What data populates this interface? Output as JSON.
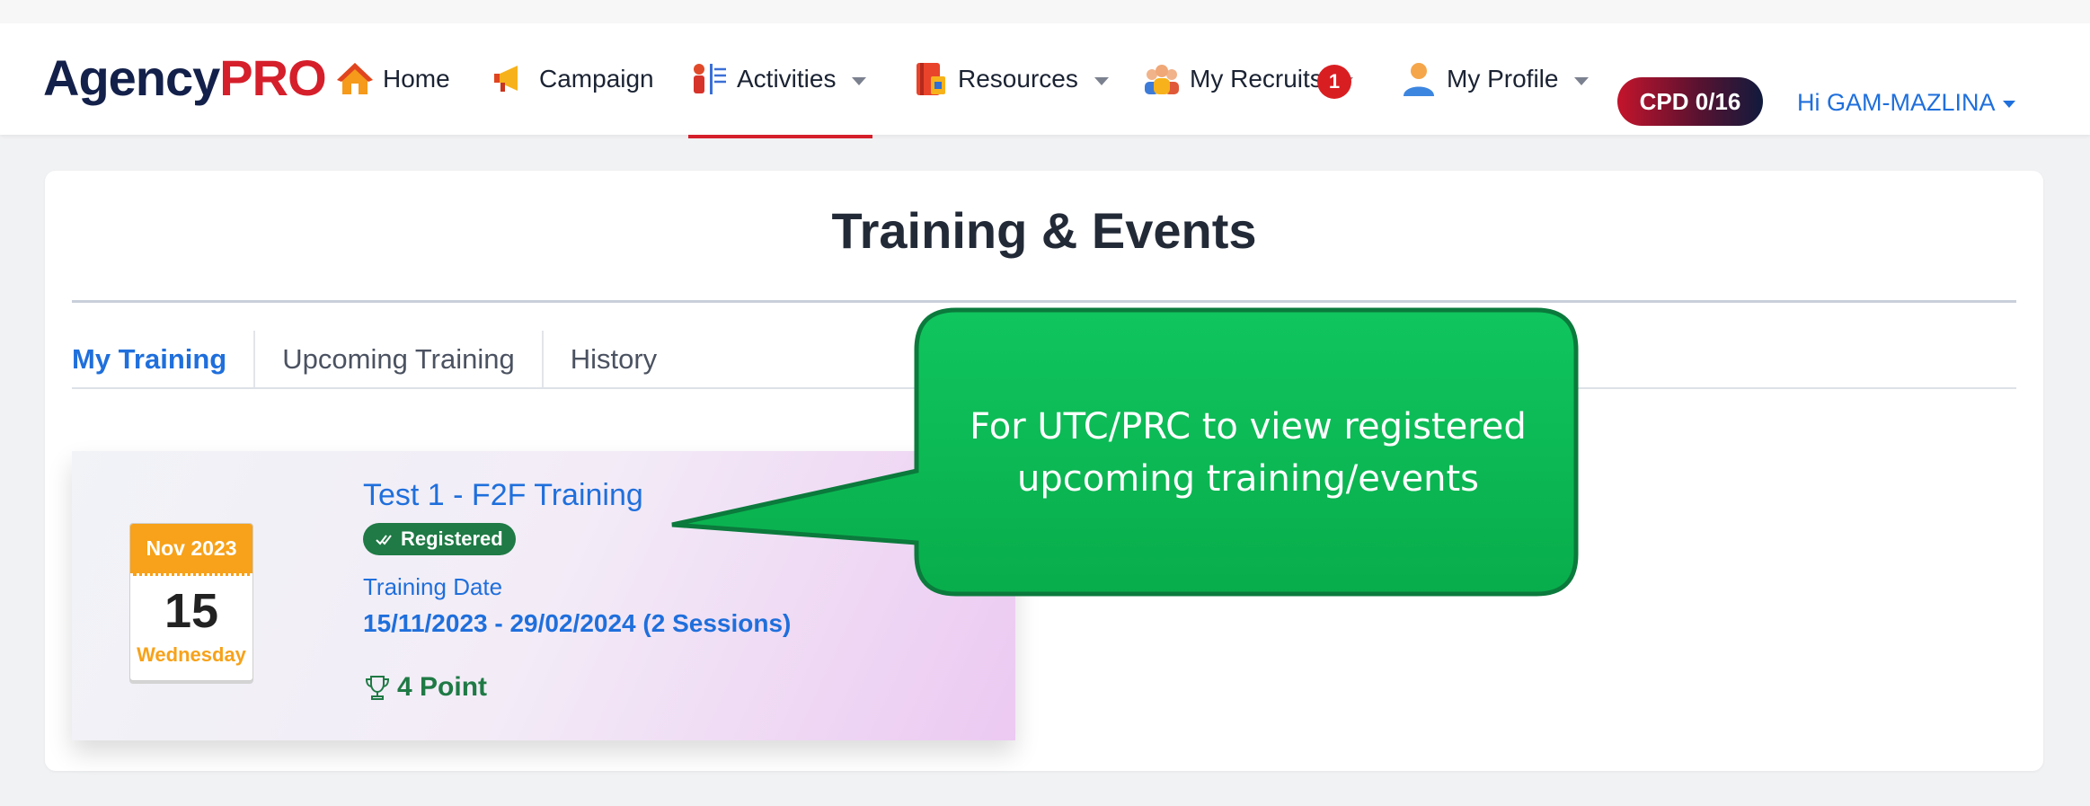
{
  "app": {
    "logo_part1": "Agency",
    "logo_part2": "PRO"
  },
  "nav": {
    "items": [
      {
        "label": "Home",
        "icon": "home-icon",
        "has_dropdown": false
      },
      {
        "label": "Campaign",
        "icon": "megaphone-icon",
        "has_dropdown": false
      },
      {
        "label": "Activities",
        "icon": "presenter-icon",
        "has_dropdown": true,
        "active": true
      },
      {
        "label": "Resources",
        "icon": "binder-icon",
        "has_dropdown": true
      },
      {
        "label": "My Recruits",
        "icon": "team-icon",
        "has_dropdown": true,
        "badge": "1"
      },
      {
        "label": "My Profile",
        "icon": "user-icon",
        "has_dropdown": true
      }
    ],
    "cpd_label": "CPD 0/16",
    "greeting": "Hi GAM-MAZLINA"
  },
  "page": {
    "title": "Training & Events",
    "tabs": [
      {
        "label": "My Training",
        "active": true
      },
      {
        "label": "Upcoming Training",
        "active": false
      },
      {
        "label": "History",
        "active": false
      }
    ]
  },
  "training_card": {
    "calendar_month": "Nov 2023",
    "calendar_day": "15",
    "calendar_weekday": "Wednesday",
    "title": "Test 1 - F2F Training",
    "status": "Registered",
    "date_label": "Training Date",
    "date_range": "15/11/2023 - 29/02/2024 (2 Sessions)",
    "points": "4 Point"
  },
  "callout": {
    "text": "For UTC/PRC to view registered upcoming training/events"
  },
  "colors": {
    "brand_navy": "#13204a",
    "brand_red": "#d51f2b",
    "link_blue": "#1f6fdc",
    "success_green": "#1f7a45",
    "calendar_orange": "#f7a21a",
    "callout_green": "#0bb954"
  }
}
